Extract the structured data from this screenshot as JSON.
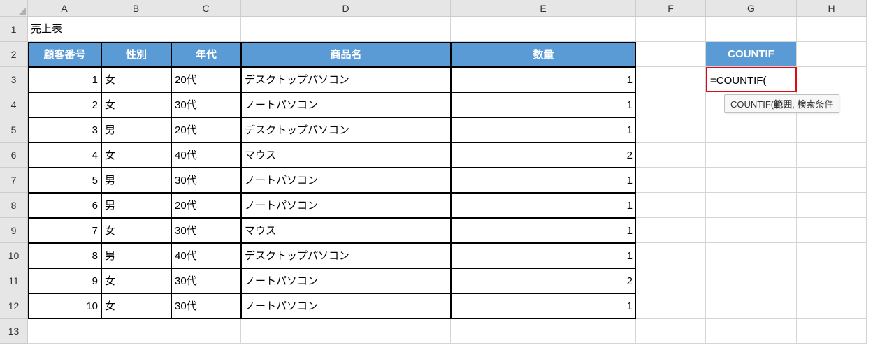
{
  "columns": [
    "A",
    "B",
    "C",
    "D",
    "E",
    "F",
    "G",
    "H"
  ],
  "rows": [
    "1",
    "2",
    "3",
    "4",
    "5",
    "6",
    "7",
    "8",
    "9",
    "10",
    "11",
    "12",
    "13"
  ],
  "a1": "売上表",
  "headers": {
    "A": "顧客番号",
    "B": "性別",
    "C": "年代",
    "D": "商品名",
    "E": "数量"
  },
  "g2": "COUNTIF",
  "g3": "=COUNTIF(",
  "tooltip": {
    "func": "COUNTIF(",
    "arg1": "範囲",
    "rest": ", 検索条件"
  },
  "data": [
    {
      "no": "1",
      "sex": "女",
      "age": "20代",
      "prod": "デスクトップパソコン",
      "qty": "1"
    },
    {
      "no": "2",
      "sex": "女",
      "age": "30代",
      "prod": "ノートパソコン",
      "qty": "1"
    },
    {
      "no": "3",
      "sex": "男",
      "age": "20代",
      "prod": "デスクトップパソコン",
      "qty": "1"
    },
    {
      "no": "4",
      "sex": "女",
      "age": "40代",
      "prod": "マウス",
      "qty": "2"
    },
    {
      "no": "5",
      "sex": "男",
      "age": "30代",
      "prod": "ノートパソコン",
      "qty": "1"
    },
    {
      "no": "6",
      "sex": "男",
      "age": "20代",
      "prod": "ノートパソコン",
      "qty": "1"
    },
    {
      "no": "7",
      "sex": "女",
      "age": "30代",
      "prod": "マウス",
      "qty": "1"
    },
    {
      "no": "8",
      "sex": "男",
      "age": "40代",
      "prod": "デスクトップパソコン",
      "qty": "1"
    },
    {
      "no": "9",
      "sex": "女",
      "age": "30代",
      "prod": "ノートパソコン",
      "qty": "2"
    },
    {
      "no": "10",
      "sex": "女",
      "age": "30代",
      "prod": "ノートパソコン",
      "qty": "1"
    }
  ]
}
